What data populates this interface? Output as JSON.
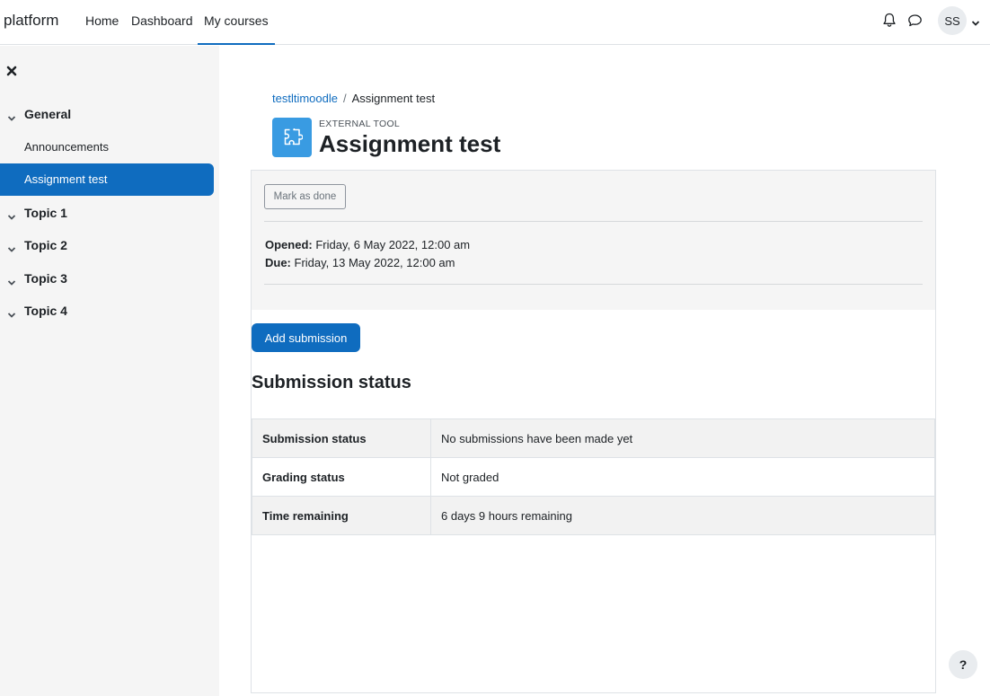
{
  "navbar": {
    "brand": "platform",
    "links": [
      {
        "label": "Home"
      },
      {
        "label": "Dashboard"
      },
      {
        "label": "My courses",
        "active": true
      }
    ],
    "notifications_icon": "bell-icon",
    "messages_icon": "chat-bubble-icon",
    "user_initials": "SS",
    "user_menu_icon": "chevron-down-icon"
  },
  "drawer": {
    "close_icon": "close-icon",
    "sections": [
      {
        "title": "General",
        "activities": [
          "Announcements",
          "Assignment test"
        ]
      },
      {
        "title": "Topic 1"
      },
      {
        "title": "Topic 2"
      },
      {
        "title": "Topic 3"
      },
      {
        "title": "Topic 4"
      }
    ],
    "active_activity": "Assignment test"
  },
  "breadcrumb": {
    "course": "testltimoodle",
    "separator": "/",
    "current": "Assignment test"
  },
  "header": {
    "icon": "puzzle-piece-icon",
    "pretitle": "EXTERNAL TOOL",
    "title": "Assignment test"
  },
  "info": {
    "mark_done_label": "Mark as done",
    "opened_label": "Opened:",
    "opened_value": "Friday, 6 May 2022, 12:00 am",
    "due_label": "Due:",
    "due_value": "Friday, 13 May 2022, 12:00 am"
  },
  "actions": {
    "add_submission_label": "Add submission"
  },
  "submission": {
    "heading": "Submission status",
    "rows": [
      {
        "label": "Submission status",
        "value": "No submissions have been made yet"
      },
      {
        "label": "Grading status",
        "value": "Not graded"
      },
      {
        "label": "Time remaining",
        "value": "6 days 9 hours remaining"
      }
    ]
  },
  "footer": {
    "help_label": "?"
  },
  "colors": {
    "primary": "#0f6cbf",
    "activity_icon_bg": "#399be2",
    "drawer_bg": "#f5f5f5"
  }
}
